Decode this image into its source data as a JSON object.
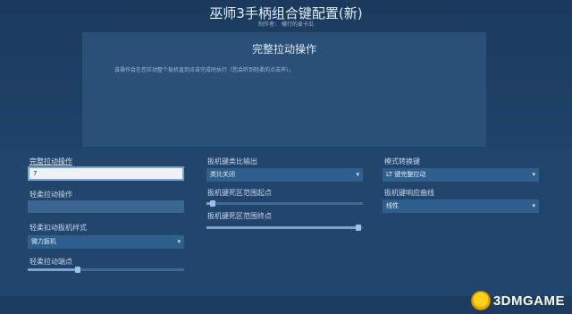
{
  "header": {
    "title": "巫师3手柄组合键配置(新)",
    "subtitle": "制作者：  横行的麦卡瓜"
  },
  "dialog": {
    "title": "完整拉动操作",
    "description": "该操作会在您拉动整个扳机直到点击完成时执行（您会听到轻柔的点击声）。"
  },
  "col1": {
    "full_pull_label": "完整拉动操作",
    "full_pull_value": "7",
    "soft_pull_label": "轻柔拉动操作",
    "soft_pull_style_label": "轻柔扣动扳机样式",
    "soft_pull_style_value": "微力扳机",
    "soft_pull_threshold_label": "轻柔拉动端点",
    "soft_pull_threshold_level": 0.32
  },
  "col2": {
    "analog_output_label": "扳机键类比输出",
    "analog_output_value": "类比关闭",
    "deadzone_start_label": "扳机键死区范围起点",
    "deadzone_start_level": 0.04,
    "deadzone_end_label": "扳机键死区范围终点",
    "deadzone_end_level": 0.97
  },
  "col3": {
    "mode_switch_label": "模式转换键",
    "mode_switch_value": "LT 键完整拉动",
    "response_curve_label": "扳机键响应曲线",
    "response_curve_value": "线性"
  },
  "icons": {
    "dropdown": "▾"
  },
  "watermark": {
    "text": "3DMGAME"
  },
  "colors": {
    "background": "#1e4268",
    "panel": "#22456b",
    "accent": "#7ea6cc"
  }
}
